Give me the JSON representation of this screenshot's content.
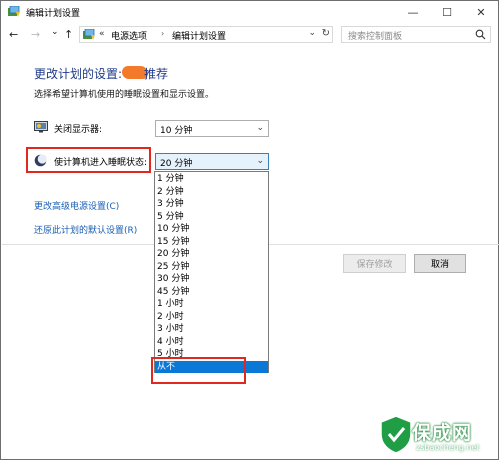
{
  "window": {
    "title": "编辑计划设置",
    "buttons": {
      "minimize": "—",
      "maximize": "☐",
      "close": "✕"
    }
  },
  "nav": {
    "back": "←",
    "forward": "→",
    "recent": "⌄",
    "up": "↑",
    "address_chevron": "«",
    "breadcrumbs": [
      "电源选项",
      "编辑计划设置"
    ],
    "separator": "›",
    "dropdown": "⌄",
    "refresh": "↻",
    "search_placeholder": "搜索控制面板"
  },
  "main": {
    "heading_prefix": "更改计划的设置:",
    "heading_suffix": "推荐",
    "subtitle": "选择希望计算机使用的睡眠设置和显示设置。",
    "display_off": {
      "label": "关闭显示器:",
      "value": "10 分钟",
      "icon": "monitor-icon"
    },
    "sleep": {
      "label": "使计算机进入睡眠状态:",
      "value": "20 分钟",
      "icon": "moon-icon"
    },
    "links": {
      "advanced": "更改高级电源设置(C)",
      "restore": "还原此计划的默认设置(R)"
    },
    "buttons": {
      "save": "保存修改",
      "cancel": "取消"
    }
  },
  "dropdown": {
    "options": [
      "1 分钟",
      "2 分钟",
      "3 分钟",
      "5 分钟",
      "10 分钟",
      "15 分钟",
      "20 分钟",
      "25 分钟",
      "30 分钟",
      "45 分钟",
      "1 小时",
      "2 小时",
      "3 小时",
      "4 小时",
      "5 小时",
      "从不"
    ],
    "selected": "从不"
  },
  "watermark": {
    "text": "保成网",
    "url": "zsbaocheng.net"
  },
  "colors": {
    "heading": "#1e3a8a",
    "link": "#1a5fb4",
    "highlight_box": "#e0281e",
    "selected": "#0a78d7",
    "blob": "#f47a2b"
  }
}
